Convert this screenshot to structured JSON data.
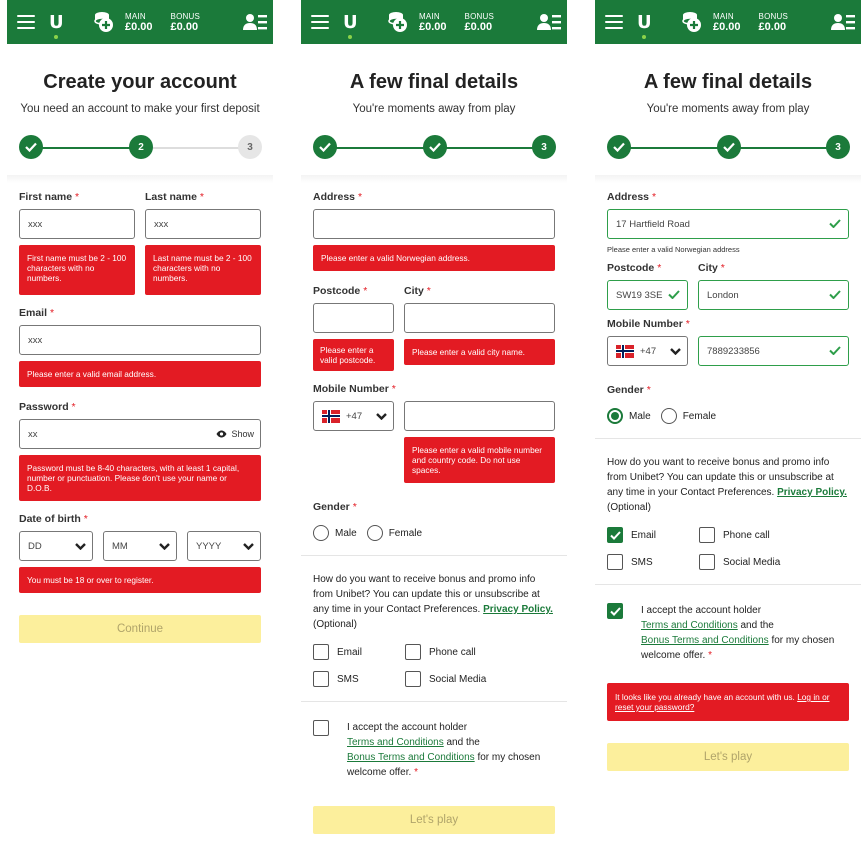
{
  "header": {
    "main_label": "MAIN",
    "main_value": "£0.00",
    "bonus_label": "BONUS",
    "bonus_value": "£0.00",
    "logo": "U"
  },
  "colors": {
    "brand": "#1b7a3a",
    "error": "#e31b23",
    "button_disabled": "#fcef9c"
  },
  "icons": [
    "menu-icon",
    "unibet-logo",
    "coins-add-icon",
    "account-icon",
    "checkmark-icon",
    "chevron-down-icon",
    "eye-icon",
    "norway-flag-icon"
  ],
  "s1": {
    "title": "Create your account",
    "subtitle": "You need an account to make your first deposit",
    "step1": "1",
    "step2": "2",
    "step3": "3",
    "first_name_label": "First name",
    "last_name_label": "Last name",
    "first_name_value": "xxx",
    "last_name_value": "xxx",
    "first_name_error": "First name must be 2 - 100 characters with no numbers.",
    "last_name_error": "Last name must be 2 - 100 characters with no numbers.",
    "email_label": "Email",
    "email_value": "xxx",
    "email_error": "Please enter a valid email address.",
    "password_label": "Password",
    "password_value": "xx",
    "show_label": "Show",
    "password_error": "Password must be 8-40 characters, with at least 1 capital, number or punctuation. Please don't use your name or D.O.B.",
    "dob_label": "Date of birth",
    "dd": "DD",
    "mm": "MM",
    "yyyy": "YYYY",
    "dob_error": "You must be 18 or over to register.",
    "continue": "Continue"
  },
  "s2": {
    "title": "A few final details",
    "subtitle": "You're moments away from play",
    "step3": "3",
    "address_label": "Address",
    "address_error": "Please enter a valid Norwegian address.",
    "postcode_label": "Postcode",
    "city_label": "City",
    "postcode_error": "Please enter a valid postcode.",
    "city_error": "Please enter a valid city name.",
    "mobile_label": "Mobile Number",
    "dial_code": "+47",
    "mobile_error": "Please enter a valid mobile number and country code. Do not use spaces.",
    "gender_label": "Gender",
    "male": "Male",
    "female": "Female",
    "promo_text": "How do you want to receive bonus and promo info from Unibet? You can update this or unsubscribe at any time in your Contact Preferences.",
    "privacy_link": "Privacy Policy.",
    "optional": "(Optional)",
    "email_opt": "Email",
    "phone_opt": "Phone call",
    "sms_opt": "SMS",
    "social_opt": "Social Media",
    "accept_text": "I accept the account holder",
    "terms_link": "Terms and Conditions",
    "and_the": "and the",
    "bonus_terms_link": "Bonus Terms and Conditions",
    "accept_tail": "for my chosen welcome offer.",
    "lets_play": "Let's play"
  },
  "s3": {
    "title": "A few final details",
    "subtitle": "You're moments away from play",
    "step3": "3",
    "address_label": "Address",
    "address_value": "17 Hartfield Road",
    "address_hint": "Please enter a valid Norwegian address",
    "postcode_label": "Postcode",
    "postcode_value": "SW19 3SE",
    "city_label": "City",
    "city_value": "London",
    "mobile_label": "Mobile Number",
    "dial_code": "+47",
    "mobile_value": "7889233856",
    "gender_label": "Gender",
    "male": "Male",
    "female": "Female",
    "promo_text": "How do you want to receive bonus and promo info from Unibet? You can update this or unsubscribe at any time in your Contact Preferences.",
    "privacy_link": "Privacy Policy.",
    "optional": "(Optional)",
    "email_opt": "Email",
    "phone_opt": "Phone call",
    "sms_opt": "SMS",
    "social_opt": "Social Media",
    "accept_text": "I accept the account holder",
    "terms_link": "Terms and Conditions",
    "and_the": "and the",
    "bonus_terms_link": "Bonus Terms and Conditions",
    "accept_tail": "for my chosen welcome offer.",
    "account_error": "It looks like you already have an account with us.",
    "login_link": "Log in or reset your password?",
    "lets_play": "Let's play"
  }
}
